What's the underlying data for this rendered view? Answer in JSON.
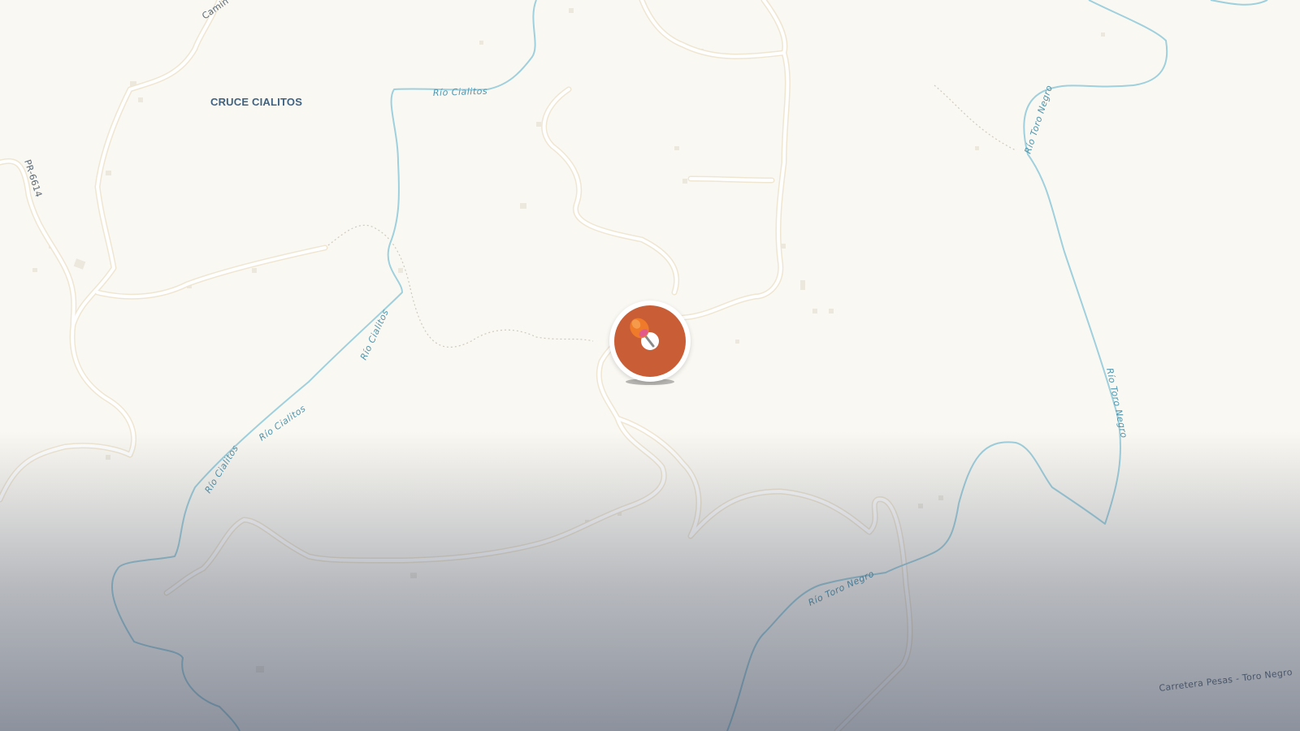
{
  "map": {
    "place_labels": [
      "CRUCE CIALITOS"
    ],
    "river_labels": [
      "Río Cialitos",
      "Río Cialitos",
      "Río Cialitos",
      "Río Cialitos",
      "Río Toro Negro",
      "Río Toro Negro",
      "Río Toro Negro"
    ],
    "road_labels": [
      "PR-6614",
      "Carretera Pesas - Toro Negro",
      "Camin"
    ],
    "colors": {
      "land": "#faf8f2",
      "road": "#ffffff",
      "road_casing": "#efe6d2",
      "river": "#9fd0dd",
      "river_label": "#4f95ad",
      "place_label": "#3f6282",
      "marker": "#c85d36"
    }
  },
  "marker": {
    "icon": "map-pin-icon",
    "color": "#c85d36"
  }
}
